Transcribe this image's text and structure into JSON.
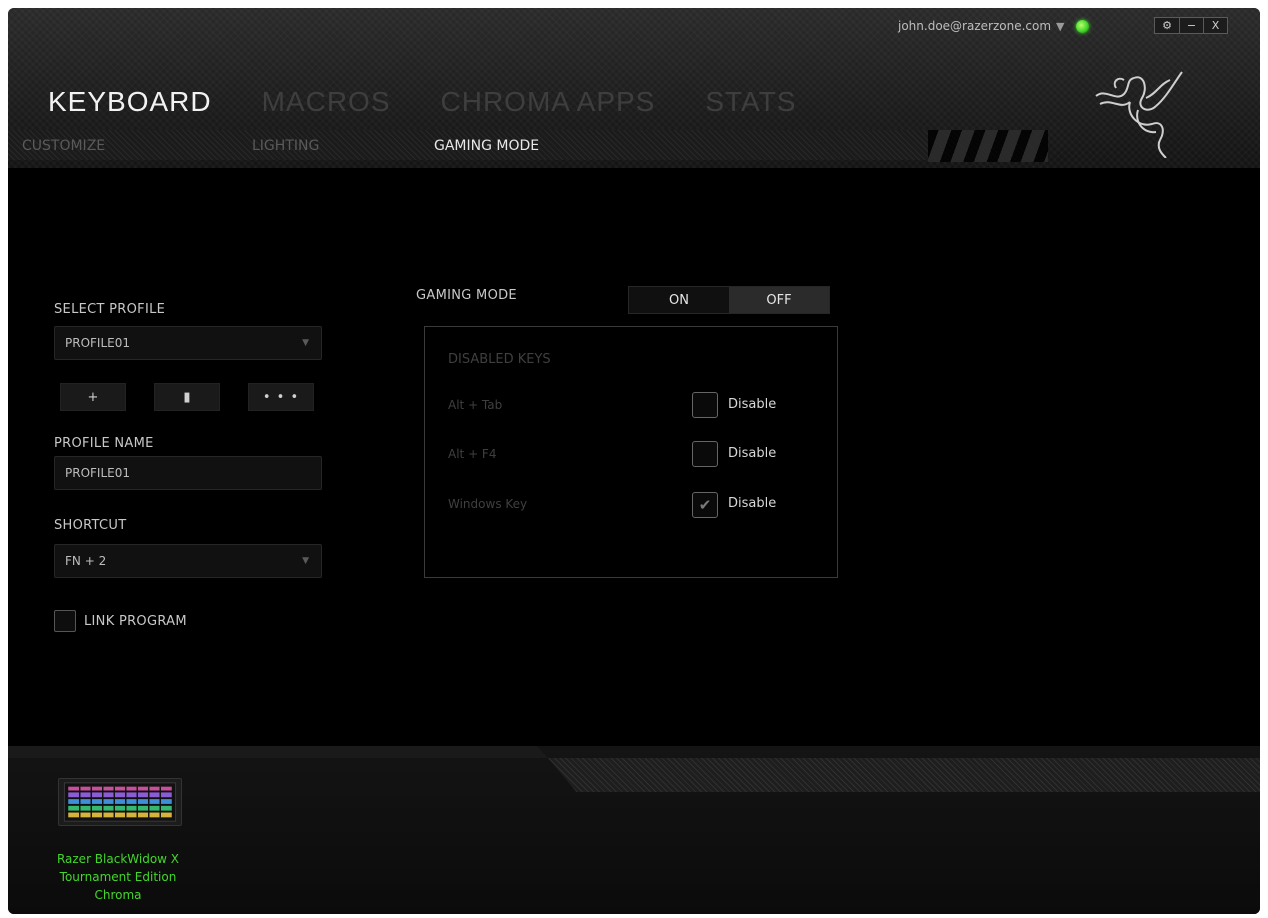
{
  "account": {
    "email": "john.doe@razerzone.com"
  },
  "window_controls": {
    "settings": "⚙",
    "minimize": "−",
    "close": "X"
  },
  "main_tabs": [
    "KEYBOARD",
    "MACROS",
    "CHROMA APPS",
    "STATS"
  ],
  "sub_tabs": [
    "CUSTOMIZE",
    "LIGHTING",
    "GAMING MODE"
  ],
  "active_main_tab": "KEYBOARD",
  "active_sub_tab": "GAMING MODE",
  "profile": {
    "select_label": "SELECT PROFILE",
    "selected": "PROFILE01",
    "add_label": "+",
    "delete_label": "▮",
    "more_label": "• • •",
    "name_label": "PROFILE NAME",
    "name_value": "PROFILE01",
    "shortcut_label": "SHORTCUT",
    "shortcut_value": "FN + 2",
    "link_program_label": "LINK PROGRAM",
    "link_program_checked": false
  },
  "gaming_mode": {
    "label": "GAMING MODE",
    "on_label": "ON",
    "off_label": "OFF",
    "selected": "OFF",
    "disabled_keys_title": "DISABLED KEYS",
    "keys": [
      {
        "name": "Alt + Tab",
        "action": "Disable",
        "checked": false
      },
      {
        "name": "Alt + F4",
        "action": "Disable",
        "checked": false
      },
      {
        "name": "Windows Key",
        "action": "Disable",
        "checked": true
      }
    ]
  },
  "device": {
    "name_line1": "Razer BlackWidow X",
    "name_line2": "Tournament Edition",
    "name_line3": "Chroma"
  },
  "colors": {
    "accent": "#44d62c",
    "background": "#000000"
  }
}
